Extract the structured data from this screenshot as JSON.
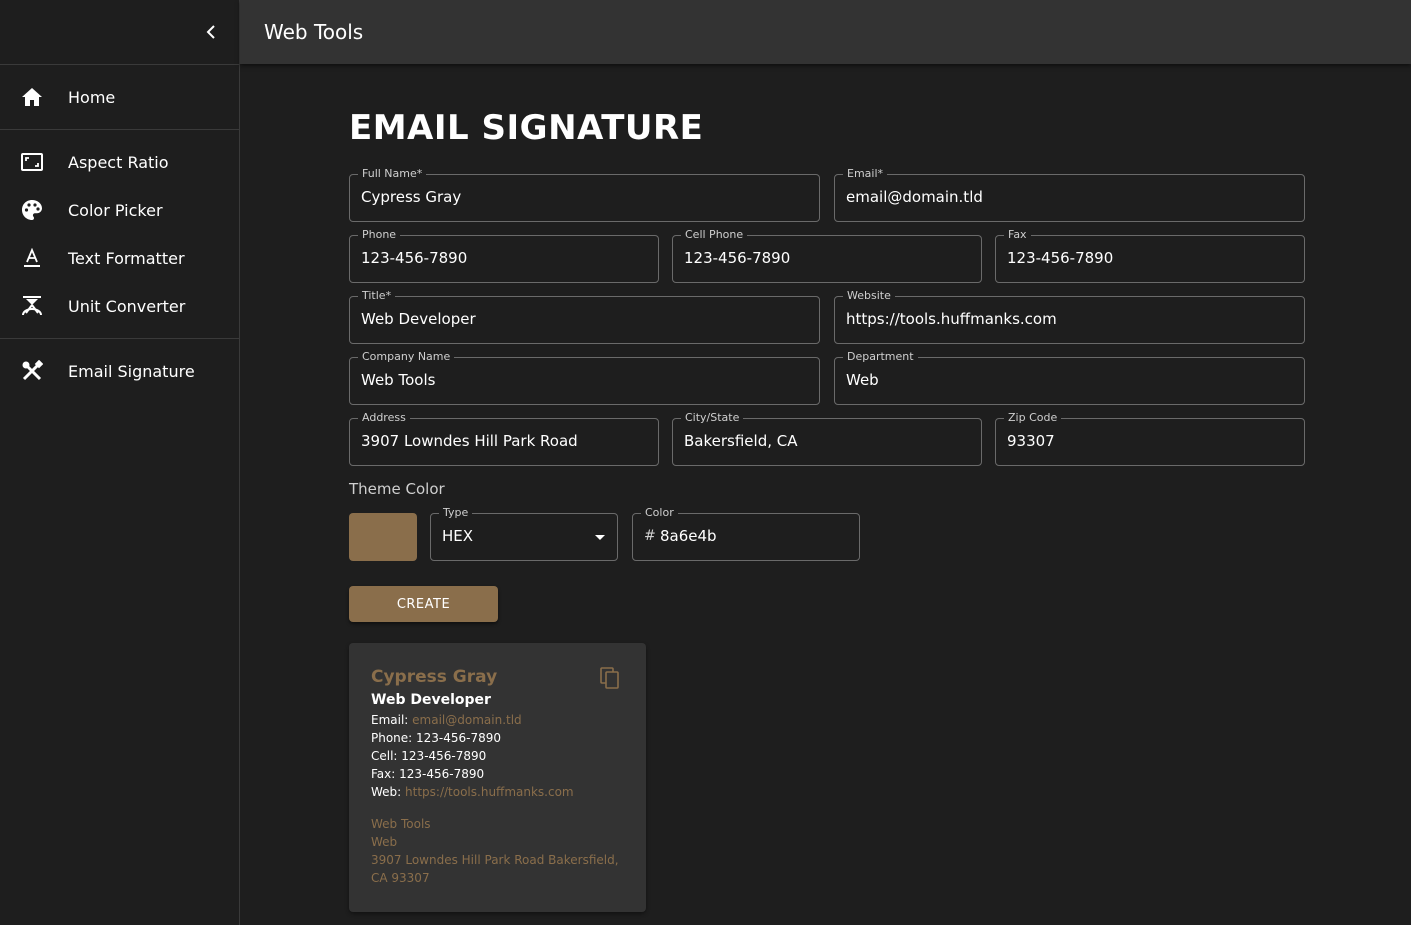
{
  "app": {
    "title": "Web Tools"
  },
  "colors": {
    "accent": "#8a6e4b",
    "appbar": "#333333",
    "background": "#1e1e1e"
  },
  "sidebar": {
    "collapse_icon": "chevron-left-icon",
    "items": [
      {
        "label": "Home",
        "icon": "home-icon"
      },
      {
        "label": "Aspect Ratio",
        "icon": "aspect-ratio-icon"
      },
      {
        "label": "Color Picker",
        "icon": "palette-icon"
      },
      {
        "label": "Text Formatter",
        "icon": "text-format-icon"
      },
      {
        "label": "Unit Converter",
        "icon": "unit-converter-icon"
      },
      {
        "label": "Email Signature",
        "icon": "tools-icon"
      }
    ]
  },
  "page": {
    "title": "EMAIL SIGNATURE"
  },
  "form": {
    "full_name": {
      "label": "Full Name",
      "required_mark": "*",
      "value": "Cypress Gray"
    },
    "email": {
      "label": "Email",
      "required_mark": "*",
      "value": "email@domain.tld"
    },
    "phone": {
      "label": "Phone",
      "value": "123-456-7890"
    },
    "cell_phone": {
      "label": "Cell Phone",
      "value": "123-456-7890"
    },
    "fax": {
      "label": "Fax",
      "value": "123-456-7890"
    },
    "title": {
      "label": "Title",
      "required_mark": "*",
      "value": "Web Developer"
    },
    "website": {
      "label": "Website",
      "value": "https://tools.huffmanks.com"
    },
    "company_name": {
      "label": "Company Name",
      "value": "Web Tools"
    },
    "department": {
      "label": "Department",
      "value": "Web"
    },
    "address": {
      "label": "Address",
      "value": "3907 Lowndes Hill Park Road"
    },
    "city_state": {
      "label": "City/State",
      "value": "Bakersfield, CA"
    },
    "zip_code": {
      "label": "Zip Code",
      "value": "93307"
    }
  },
  "theme": {
    "label": "Theme Color",
    "type_label": "Type",
    "type_value": "HEX",
    "color_label": "Color",
    "color_prefix": "#",
    "color_value": "8a6e4b"
  },
  "create_button": {
    "label": "CREATE"
  },
  "signature": {
    "name": "Cypress Gray",
    "title": "Web Developer",
    "email_label": "Email: ",
    "email": "email@domain.tld",
    "phone_line": "Phone: 123-456-7890",
    "cell_line": "Cell: 123-456-7890",
    "fax_line": "Fax: 123-456-7890",
    "web_label": "Web: ",
    "web": "https://tools.huffmanks.com",
    "company": "Web Tools",
    "department": "Web",
    "address_line1": "3907 Lowndes Hill Park Road Bakersfield,",
    "address_line2": "CA 93307",
    "copy_icon": "copy-icon"
  }
}
